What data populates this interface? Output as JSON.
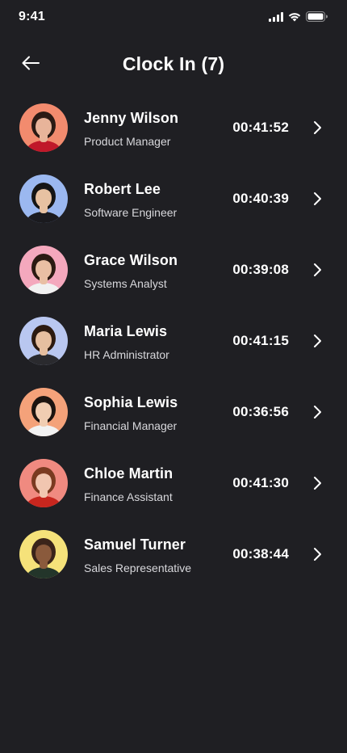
{
  "status_bar": {
    "time": "9:41"
  },
  "header": {
    "title": "Clock In (7)",
    "back_icon": "arrow-left-icon"
  },
  "employees": [
    {
      "name": "Jenny Wilson",
      "role": "Product Manager",
      "duration": "00:41:52",
      "avatar_bg": "#f28b6e",
      "skin": "#e8b49a",
      "hair": "#2a1a14",
      "shirt": "#c0182a"
    },
    {
      "name": "Robert Lee",
      "role": "Software Engineer",
      "duration": "00:40:39",
      "avatar_bg": "#9bb8f0",
      "skin": "#e7c2a2",
      "hair": "#151515",
      "shirt": "#1a1a1e"
    },
    {
      "name": "Grace Wilson",
      "role": "Systems Analyst",
      "duration": "00:39:08",
      "avatar_bg": "#f4a8bd",
      "skin": "#e9bfa4",
      "hair": "#2b1a12",
      "shirt": "#f1f1f1"
    },
    {
      "name": "Maria Lewis",
      "role": "HR Administrator",
      "duration": "00:41:15",
      "avatar_bg": "#b9c7f0",
      "skin": "#e6bfa0",
      "hair": "#2c1a10",
      "shirt": "#2a2a2e"
    },
    {
      "name": "Sophia Lewis",
      "role": "Financial Manager",
      "duration": "00:36:56",
      "avatar_bg": "#f4a27a",
      "skin": "#f0cdb2",
      "hair": "#1c1410",
      "shirt": "#f2f2f2"
    },
    {
      "name": "Chloe Martin",
      "role": "Finance Assistant",
      "duration": "00:41:30",
      "avatar_bg": "#f08a80",
      "skin": "#f1c6b0",
      "hair": "#7a3a20",
      "shirt": "#c7261e"
    },
    {
      "name": "Samuel Turner",
      "role": "Sales Representative",
      "duration": "00:38:44",
      "avatar_bg": "#f5e27a",
      "skin": "#8a5a3c",
      "hair": "#3a241a",
      "shirt": "#23352a"
    }
  ]
}
